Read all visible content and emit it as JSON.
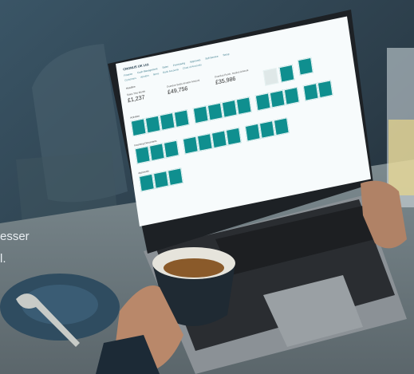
{
  "overlay": {
    "line1": "esser",
    "line2": "l."
  },
  "screen": {
    "app_title": "CRONUS UK Ltd.",
    "nav": [
      "Finance",
      "Cash Management",
      "Sales",
      "Purchasing",
      "Approvals",
      "Self-Service",
      "Setup"
    ],
    "sub_nav": [
      "Customers",
      "Vendors",
      "Items",
      "Bank Accounts",
      "Chart of Accounts"
    ],
    "section_headline": "Headline",
    "kpis": [
      {
        "label": "Sales This Month",
        "value": "£1,237"
      },
      {
        "label": "Overdue Sales Invoice Amount",
        "value": "£49,756"
      },
      {
        "label": "Overdue Purch. Invoice Amount",
        "value": "£35,986"
      }
    ],
    "group_labels": [
      "Activities",
      "Incoming Documents",
      "Approvals"
    ]
  },
  "colors": {
    "tile": "#0f8f8f",
    "screen_bg": "#f7fbfc",
    "scene_bg": "#2c3f4d"
  }
}
